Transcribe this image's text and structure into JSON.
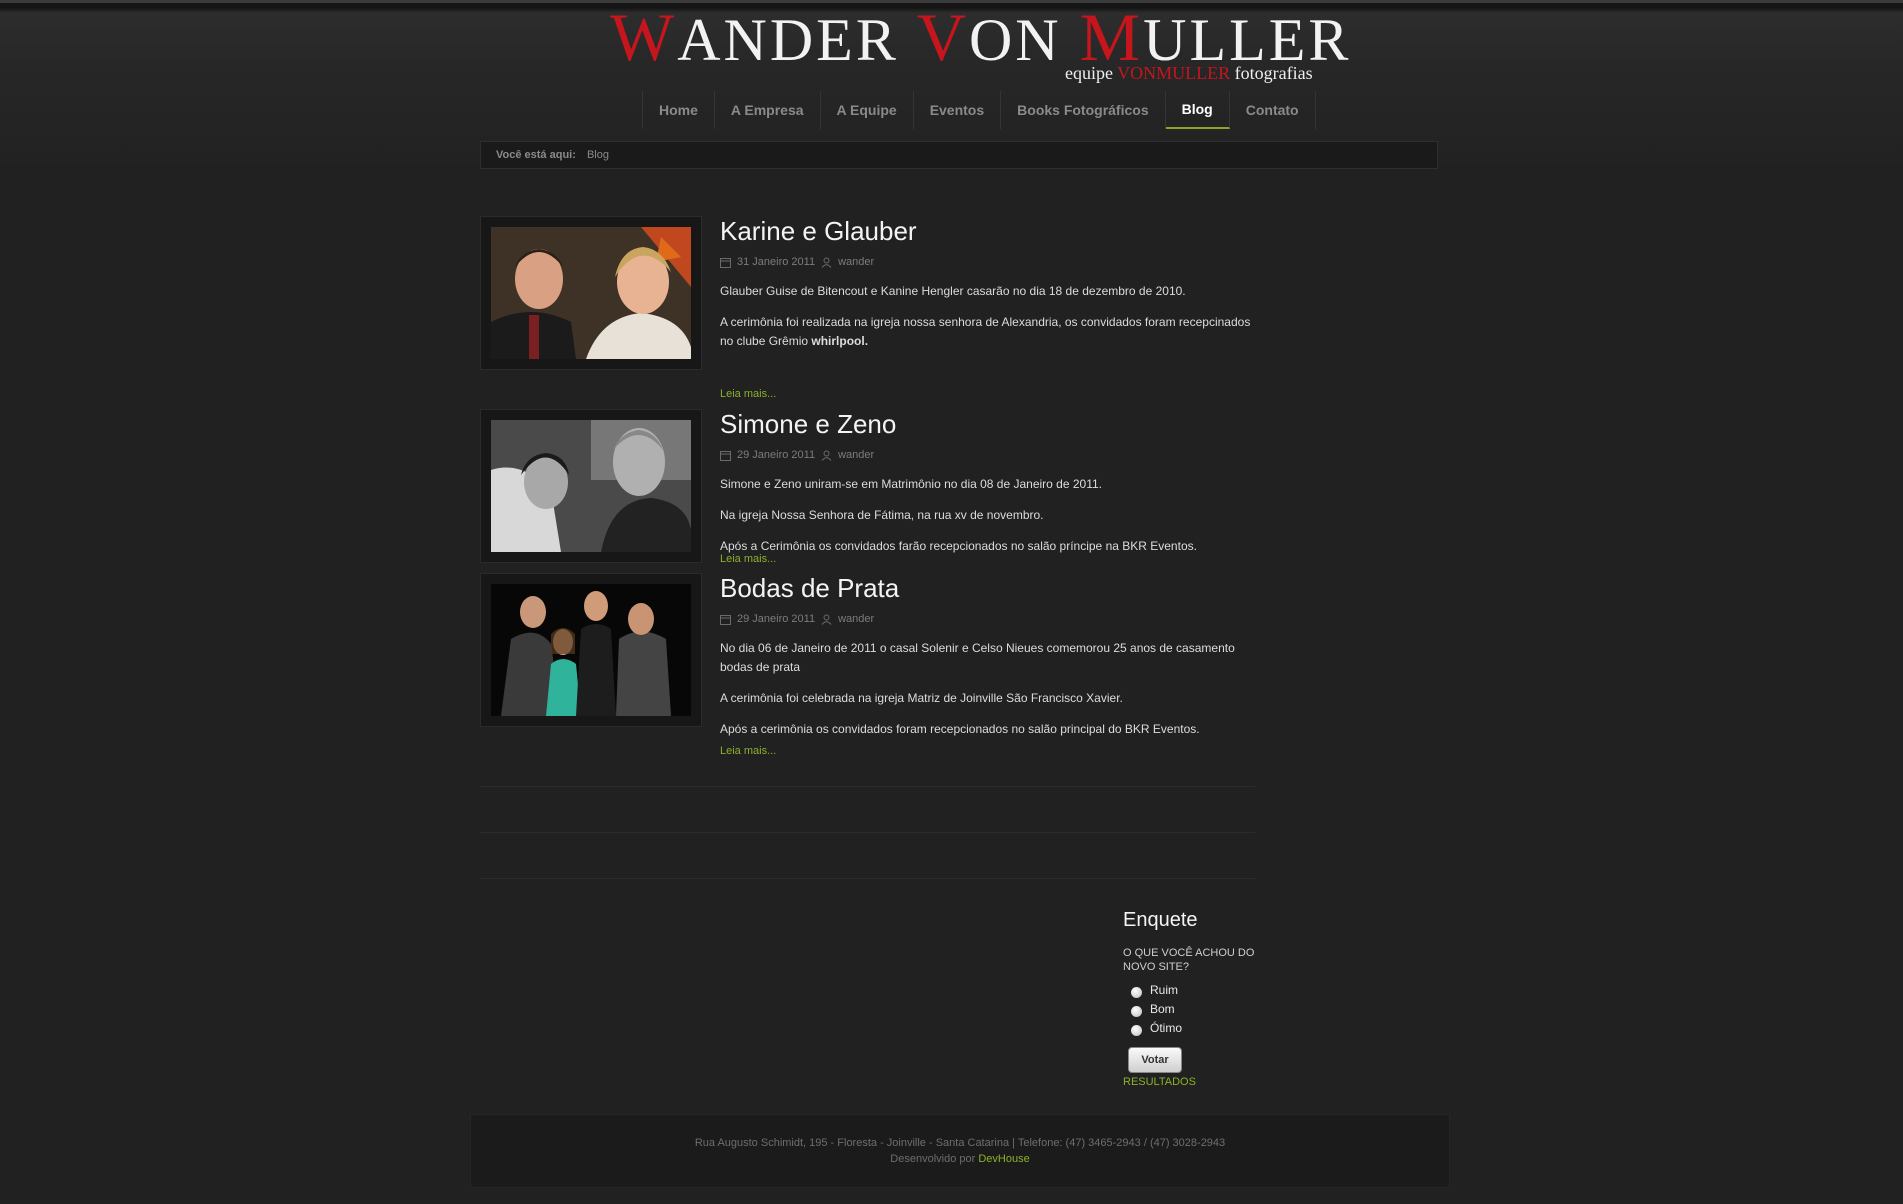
{
  "header": {
    "logo": {
      "w1": "W",
      "w1_rest": "ANDER",
      "w2": "V",
      "w2_rest": "ON",
      "w3": "M",
      "w3_rest": "ULLER"
    },
    "tagline": {
      "pre": "equipe ",
      "brand": "VONMULLER",
      "post": " fotografias"
    }
  },
  "nav": {
    "items": [
      "Home",
      "A Empresa",
      "A Equipe",
      "Eventos",
      "Books Fotográficos",
      "Blog",
      "Contato"
    ],
    "active": "Blog"
  },
  "breadcrumb": {
    "label": "Você está aqui:",
    "current": "Blog"
  },
  "posts": [
    {
      "title": "Karine e Glauber",
      "date": "31 Janeiro 2011",
      "author": "wander",
      "paragraphs": [
        " Glauber Guise de Bitencout e Kanine Hengler casarão no dia 18 de dezembro de 2010.",
        "A cerimônia foi realizada na igreja nossa senhora de Alexandria, os convidados foram recepcinados no clube Grêmio "
      ],
      "bold": "whirlpool.",
      "readmore": "Leia mais..."
    },
    {
      "title": "Simone e Zeno",
      "date": "29 Janeiro 2011",
      "author": "wander",
      "paragraphs": [
        "Simone e Zeno uniram-se em Matrimônio no dia 08 de Janeiro de 2011.",
        "Na igreja Nossa Senhora de Fátima, na rua xv de novembro.",
        "Após a Cerimônia os convidados farão recepcionados no salão príncipe na BKR Eventos."
      ],
      "readmore": "Leia mais..."
    },
    {
      "title": "Bodas de Prata",
      "date": "29 Janeiro 2011",
      "author": "wander",
      "paragraphs": [
        "No dia 06 de Janeiro de 2011 o casal Solenir e Celso Nieues comemorou 25 anos de casamento bodas de prata",
        "A cerimônia foi celebrada na igreja Matriz de Joinville São Francisco Xavier.",
        "Após a cerimônia os convidados foram recepcionados no salão principal do BKR Eventos."
      ],
      "readmore": "Leia mais..."
    }
  ],
  "poll": {
    "title": "Enquete",
    "question": "O QUE VOCÊ ACHOU DO NOVO SITE?",
    "options": [
      "Ruim",
      "Bom",
      "Ótimo"
    ],
    "vote_label": "Votar",
    "results_label": "RESULTADOS"
  },
  "footer": {
    "address": "Rua Augusto Schimidt, 195 - Floresta - Joinville - Santa Catarina | Telefone: (47) 3465-2943 / (47) 3028-2943",
    "dev_prefix": "Desenvolvido por ",
    "dev_link": "DevHouse"
  },
  "colors": {
    "accent": "#8ab12a",
    "brand_red": "#c4161c",
    "background": "#212121"
  }
}
